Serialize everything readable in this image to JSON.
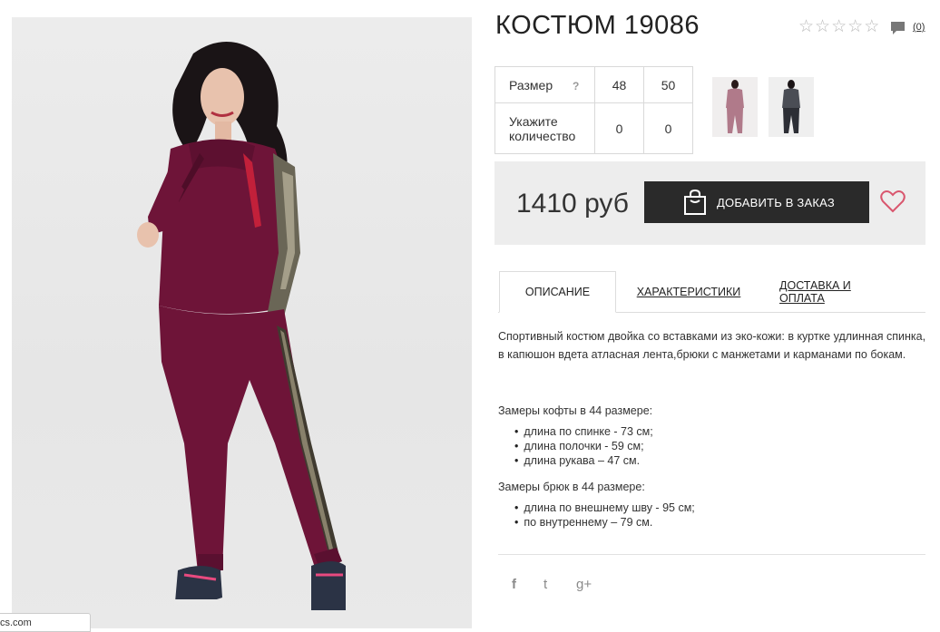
{
  "product": {
    "title": "КОСТЮМ 19086",
    "rating_stars": 5,
    "comment_count": "(0)"
  },
  "sizes_table": {
    "size_label": "Размер",
    "help_mark": "?",
    "sizes": [
      "48",
      "50"
    ],
    "qty_label_line1": "Укажите",
    "qty_label_line2": "количество",
    "quantities": [
      "0",
      "0"
    ]
  },
  "thumbnails": [
    "thumbnail-burgundy-suit",
    "thumbnail-gray-suit"
  ],
  "buy": {
    "price": "1410 руб",
    "add_button_label": "ДОБАВИТЬ В ЗАКАЗ"
  },
  "tabs": [
    {
      "label": "ОПИСАНИЕ",
      "active": true
    },
    {
      "label": "ХАРАКТЕРИСТИКИ",
      "active": false
    },
    {
      "label": "ДОСТАВКА И ОПЛАТА",
      "active": false
    }
  ],
  "description": "Спортивный костюм двойка со вставками из эко-кожи: в куртке удлинная спинка, в капюшон вдета атласная лента,брюки с манжетами и карманами по бокам.",
  "jacket_measurements": {
    "title": "Замеры кофты в 44 размере:",
    "items": [
      "длина по спинке - 73 см;",
      "длина полочки - 59 см;",
      "длина рукава – 47 см."
    ]
  },
  "pants_measurements": {
    "title": "Замеры брюк в 44 размере:",
    "items": [
      "длина по внешнему шву - 95 см;",
      "по внутреннему – 79 см."
    ]
  },
  "social": {
    "facebook": "f",
    "twitter": "t",
    "google_plus": "g+"
  },
  "url_chip": "cs.com",
  "colors": {
    "burgundy": "#6e1438",
    "button_dark": "#2a2a2a",
    "heart": "#d9566e",
    "buy_box_bg": "#ededed"
  }
}
